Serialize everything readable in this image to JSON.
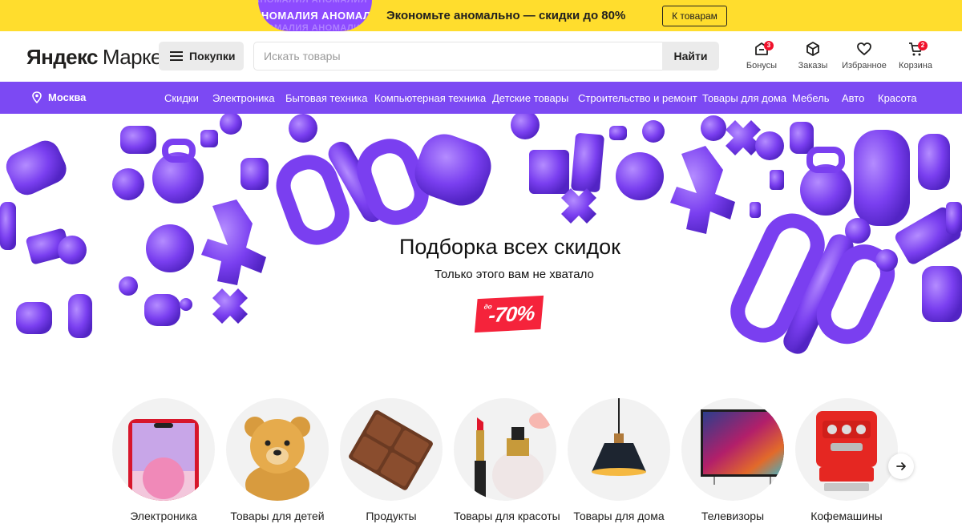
{
  "promo": {
    "badge_text": "АНОМАЛИЯ АНОМАЛИЯ",
    "text": "Экономьте аномально — скидки до 80%",
    "button": "К товарам"
  },
  "header": {
    "logo_bold": "Яндекс",
    "logo_thin": "Маркет",
    "purchases_button": "Покупки",
    "search_placeholder": "Искать товары",
    "search_button": "Найти",
    "icons": [
      {
        "name": "bonus-icon",
        "label": "Бонусы",
        "badge": "3"
      },
      {
        "name": "orders-icon",
        "label": "Заказы"
      },
      {
        "name": "favorites-icon",
        "label": "Избранное"
      },
      {
        "name": "cart-icon",
        "label": "Корзина",
        "badge": "2"
      }
    ]
  },
  "nav": {
    "city": "Москва",
    "categories": [
      "Скидки",
      "Электроника",
      "Бытовая техника",
      "Компьютерная техника",
      "Детские товары",
      "Строительство и ремонт",
      "Товары для дома",
      "Мебель",
      "Авто",
      "Красота"
    ]
  },
  "banner": {
    "title": "Подборка всех скидок",
    "subtitle": "Только этого вам не хватало",
    "tag_prefix": "до",
    "tag_value": "-70%"
  },
  "categories": [
    {
      "label": "Электроника",
      "icon": "smartphone-icon"
    },
    {
      "label": "Товары для детей",
      "icon": "teddy-bear-icon"
    },
    {
      "label": "Продукты",
      "icon": "chocolate-icon"
    },
    {
      "label": "Товары для красоты",
      "icon": "cosmetics-icon"
    },
    {
      "label": "Товары для дома",
      "icon": "lamp-icon"
    },
    {
      "label": "Телевизоры",
      "icon": "tv-icon"
    },
    {
      "label": "Кофемашины",
      "icon": "coffee-machine-icon"
    }
  ],
  "colors": {
    "promo_yellow": "#ffdd2d",
    "nav_purple": "#7c49f3",
    "badge_red": "#f0112b",
    "sale_red": "#f5233b"
  }
}
